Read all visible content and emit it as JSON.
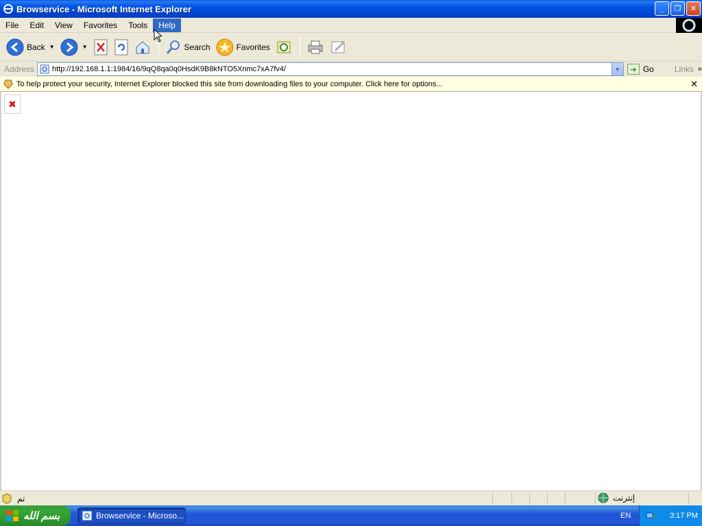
{
  "window": {
    "title": "Browservice - Microsoft Internet Explorer"
  },
  "menu": {
    "items": [
      "File",
      "Edit",
      "View",
      "Favorites",
      "Tools",
      "Help"
    ]
  },
  "toolbar": {
    "back_label": "Back",
    "search_label": "Search",
    "favorites_label": "Favorites"
  },
  "address": {
    "label": "Address",
    "url": "http://192.168.1.1:1984/16/9qQ8qa0q0HsdK9B8kNTO5Xnmc7xA7fv4/",
    "go_label": "Go",
    "links_label": "Links"
  },
  "infobar": {
    "message": "To help protect your security, Internet Explorer blocked this site from downloading files to your computer. Click here for options..."
  },
  "status": {
    "text": "تم",
    "zone": "إنترنت"
  },
  "taskbar": {
    "start_label": "بسم الله",
    "task_label": "Browservice - Microso...",
    "language": "EN",
    "clock": "3:17 PM"
  }
}
